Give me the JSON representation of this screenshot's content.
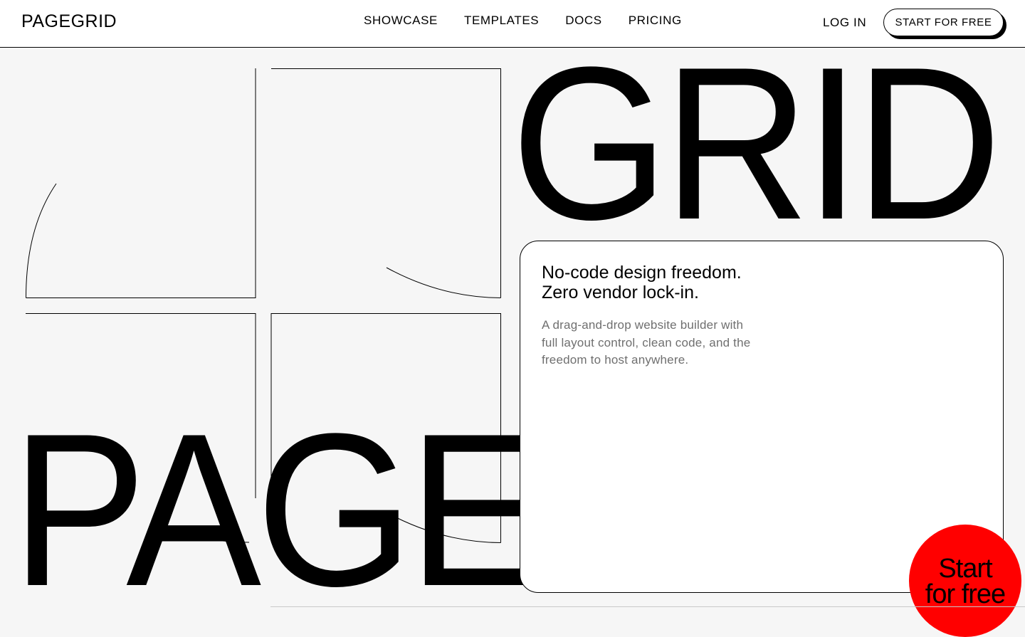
{
  "header": {
    "logo": "PAGEGRID",
    "nav": [
      "SHOWCASE",
      "TEMPLATES",
      "DOCS",
      "PRICING"
    ],
    "login": "LOG IN",
    "cta": "START FOR FREE"
  },
  "hero": {
    "word_top": "GRID",
    "word_bottom": "PAGE",
    "headline_line1": "No-code design freedom.",
    "headline_line2": "Zero vendor lock-in.",
    "body_line1": "A drag-and-drop website builder with",
    "body_line2": "full layout control, clean code, and the",
    "body_line3": "freedom to host anywhere.",
    "circle_cta_line1": "Start",
    "circle_cta_line2": "for free"
  },
  "colors": {
    "background": "#f6f6f6",
    "header_bg": "#ffffff",
    "accent_red": "#ff0000",
    "body_text_gray": "#6f6f6f"
  }
}
